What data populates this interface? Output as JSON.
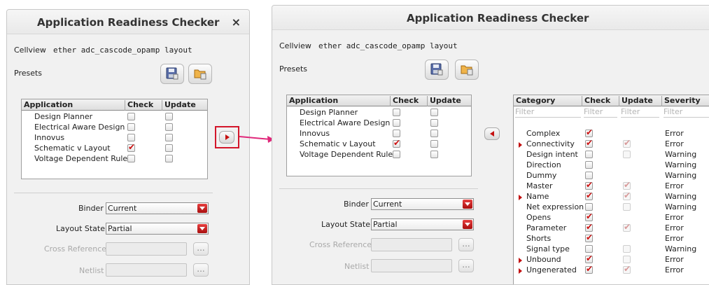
{
  "left_window": {
    "title": "Application Readiness Checker",
    "close_glyph": "×",
    "cellview_label": "Cellview",
    "cellview_value": "ether adc_cascode_opamp layout",
    "presets_label": "Presets",
    "preset_icons": [
      "save-preset-icon",
      "load-preset-icon"
    ],
    "table_headers": [
      "Application",
      "Check",
      "Update"
    ],
    "applications": [
      {
        "name": "Design Planner",
        "check": false,
        "update": false
      },
      {
        "name": "Electrical Aware Design",
        "check": false,
        "update": false
      },
      {
        "name": "Innovus",
        "check": false,
        "update": false
      },
      {
        "name": "Schematic v Layout",
        "check": true,
        "update": false
      },
      {
        "name": "Voltage Dependent Rule",
        "check": false,
        "update": false
      }
    ],
    "binder_label": "Binder",
    "binder_value": "Current",
    "layout_state_label": "Layout State",
    "layout_state_value": "Partial",
    "cross_reference_label": "Cross Reference",
    "netlist_label": "Netlist",
    "browse_glyph": "..."
  },
  "expand_button_icon": "play-right-icon",
  "right_window": {
    "title": "Application Readiness Checker",
    "cellview_label": "Cellview",
    "cellview_value": "ether adc_cascode_opamp layout",
    "presets_label": "Presets",
    "table_headers": [
      "Application",
      "Check",
      "Update"
    ],
    "applications": [
      {
        "name": "Design Planner",
        "check": false,
        "update": false
      },
      {
        "name": "Electrical Aware Design",
        "check": false,
        "update": false
      },
      {
        "name": "Innovus",
        "check": false,
        "update": false
      },
      {
        "name": "Schematic v Layout",
        "check": true,
        "update": false
      },
      {
        "name": "Voltage Dependent Rule",
        "check": false,
        "update": false
      }
    ],
    "binder_label": "Binder",
    "binder_value": "Current",
    "layout_state_label": "Layout State",
    "layout_state_value": "Partial",
    "cross_reference_label": "Cross Reference",
    "netlist_label": "Netlist",
    "browse_glyph": "...",
    "collapse_button_icon": "play-left-icon",
    "category_headers": [
      "Category",
      "Check",
      "Update",
      "Severity"
    ],
    "filter_placeholder": "Filter",
    "categories": [
      {
        "name": "Complex",
        "check": true,
        "update": null,
        "severity": "Error",
        "expandable": false
      },
      {
        "name": "Connectivity",
        "check": true,
        "update": true,
        "severity": "Error",
        "expandable": true
      },
      {
        "name": "Design intent",
        "check": false,
        "update": false,
        "severity": "Warning",
        "expandable": false
      },
      {
        "name": "Direction",
        "check": false,
        "update": null,
        "severity": "Warning",
        "expandable": false
      },
      {
        "name": "Dummy",
        "check": false,
        "update": null,
        "severity": "Warning",
        "expandable": false
      },
      {
        "name": "Master",
        "check": true,
        "update": true,
        "severity": "Error",
        "expandable": false
      },
      {
        "name": "Name",
        "check": true,
        "update": true,
        "severity": "Warning",
        "expandable": true
      },
      {
        "name": "Net expression",
        "check": false,
        "update": false,
        "severity": "Warning",
        "expandable": false
      },
      {
        "name": "Opens",
        "check": true,
        "update": null,
        "severity": "Error",
        "expandable": false
      },
      {
        "name": "Parameter",
        "check": true,
        "update": true,
        "severity": "Error",
        "expandable": false
      },
      {
        "name": "Shorts",
        "check": true,
        "update": null,
        "severity": "Error",
        "expandable": false
      },
      {
        "name": "Signal type",
        "check": false,
        "update": false,
        "severity": "Warning",
        "expandable": false
      },
      {
        "name": "Unbound",
        "check": true,
        "update": false,
        "severity": "Error",
        "expandable": true
      },
      {
        "name": "Ungenerated",
        "check": true,
        "update": true,
        "severity": "Error",
        "expandable": true
      }
    ]
  },
  "colors": {
    "accent_red": "#c51010",
    "callout_pink": "#d3162a",
    "arrow_magenta": "#e0287a"
  }
}
